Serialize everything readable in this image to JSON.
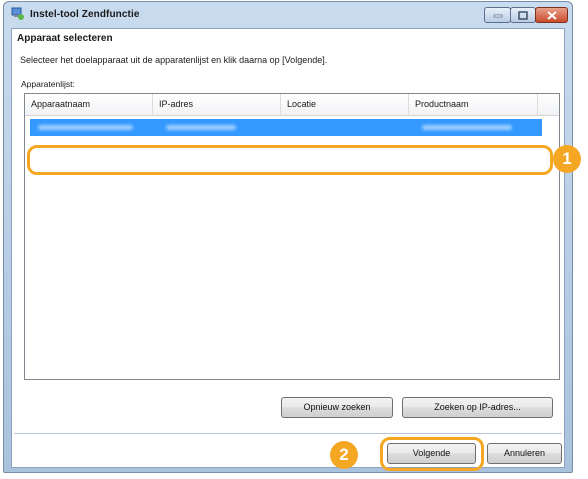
{
  "window": {
    "title": "Instel-tool Zendfunctie"
  },
  "header": {
    "heading": "Apparaat selecteren",
    "instruction": "Selecteer het doelapparaat uit de apparatenlijst en klik daarna op [Volgende]."
  },
  "device_list": {
    "label": "Apparatenlijst:",
    "columns": [
      "Apparaatnaam",
      "IP-adres",
      "Locatie",
      "Productnaam"
    ]
  },
  "buttons": {
    "search_again": "Opnieuw zoeken",
    "search_ip": "Zoeken op IP-adres...",
    "next": "Volgende",
    "cancel": "Annuleren"
  },
  "callouts": {
    "one": "1",
    "two": "2"
  },
  "colors": {
    "accent": "#f5a623",
    "selection": "#3399ff"
  },
  "icons": [
    "app-icon",
    "minimize-icon",
    "maximize-icon",
    "close-icon"
  ]
}
